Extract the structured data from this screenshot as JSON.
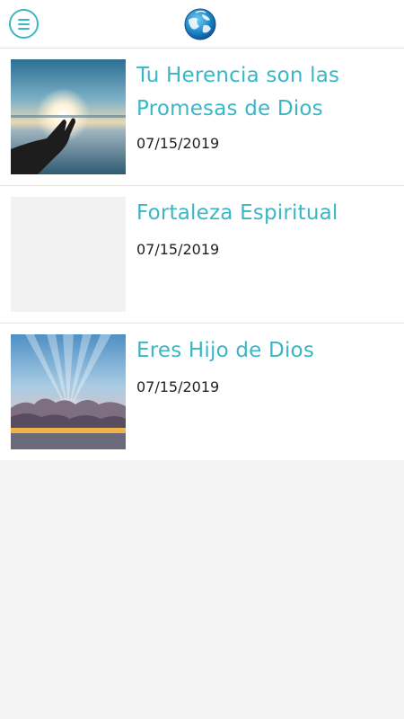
{
  "app": {
    "menu_icon": "hamburger-menu-icon",
    "logo_icon": "globe-dove-logo-icon",
    "accent_color": "#3bb6c6"
  },
  "articles": [
    {
      "title": "Tu Herencia son las Promesas de Dios",
      "date": "07/15/2019",
      "thumbnail": "hand-reaching-sunset-lake"
    },
    {
      "title": "Fortaleza Espiritual",
      "date": "07/15/2019",
      "thumbnail": "placeholder"
    },
    {
      "title": "Eres Hijo de Dios",
      "date": "07/15/2019",
      "thumbnail": "sun-rays-over-clouds"
    }
  ]
}
